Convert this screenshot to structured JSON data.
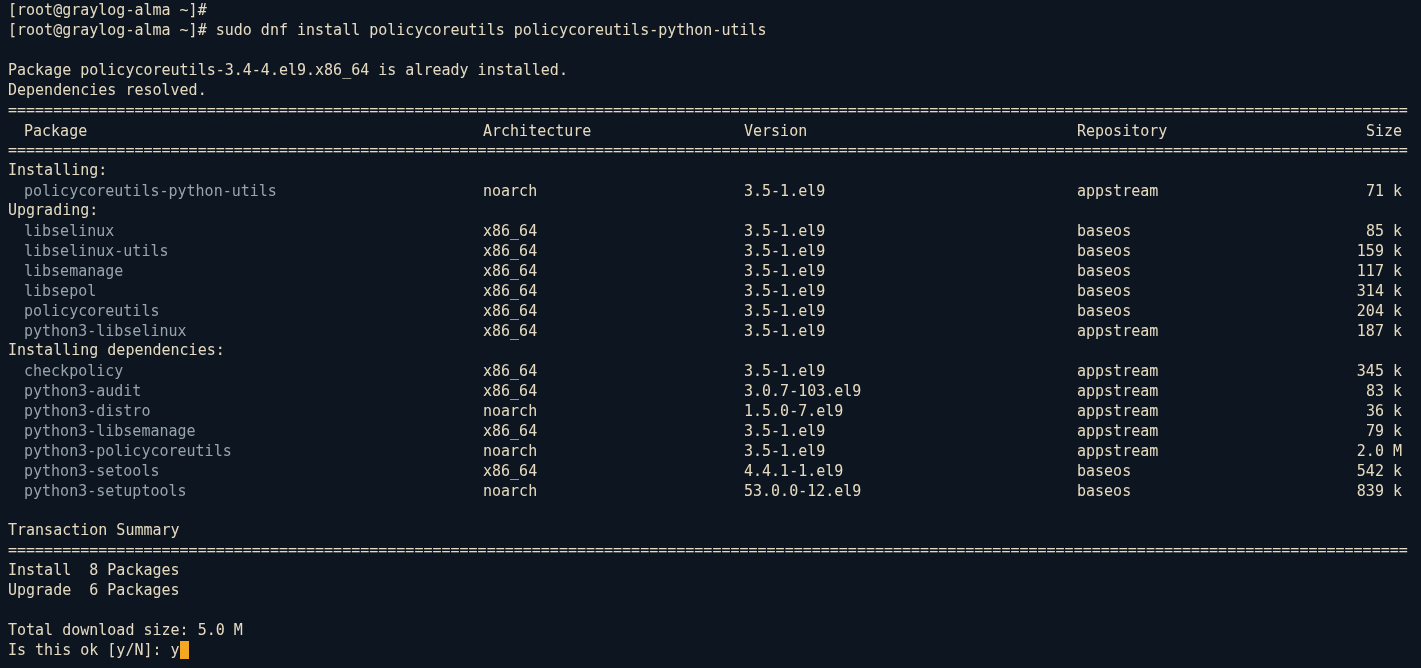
{
  "lines": [
    {
      "kind": "text",
      "text": "[root@graylog-alma ~]#"
    },
    {
      "kind": "text",
      "text": "[root@graylog-alma ~]# sudo dnf install policycoreutils policycoreutils-python-utils"
    },
    {
      "kind": "blank"
    },
    {
      "kind": "text",
      "text": "Package policycoreutils-3.4-4.el9.x86_64 is already installed."
    },
    {
      "kind": "text",
      "text": "Dependencies resolved."
    },
    {
      "kind": "rule",
      "text": "==========================================================================================================================================================="
    },
    {
      "kind": "header",
      "cells": [
        "Package",
        "Architecture",
        "Version",
        "Repository",
        "Size"
      ]
    },
    {
      "kind": "rule",
      "text": "==========================================================================================================================================================="
    },
    {
      "kind": "group",
      "text": "Installing:"
    },
    {
      "kind": "row",
      "cells": [
        "policycoreutils-python-utils",
        "noarch",
        "3.5-1.el9",
        "appstream",
        "71 k"
      ]
    },
    {
      "kind": "group",
      "text": "Upgrading:"
    },
    {
      "kind": "row",
      "cells": [
        "libselinux",
        "x86_64",
        "3.5-1.el9",
        "baseos",
        "85 k"
      ]
    },
    {
      "kind": "row",
      "cells": [
        "libselinux-utils",
        "x86_64",
        "3.5-1.el9",
        "baseos",
        "159 k"
      ]
    },
    {
      "kind": "row",
      "cells": [
        "libsemanage",
        "x86_64",
        "3.5-1.el9",
        "baseos",
        "117 k"
      ]
    },
    {
      "kind": "row",
      "cells": [
        "libsepol",
        "x86_64",
        "3.5-1.el9",
        "baseos",
        "314 k"
      ]
    },
    {
      "kind": "row",
      "cells": [
        "policycoreutils",
        "x86_64",
        "3.5-1.el9",
        "baseos",
        "204 k"
      ]
    },
    {
      "kind": "row",
      "cells": [
        "python3-libselinux",
        "x86_64",
        "3.5-1.el9",
        "appstream",
        "187 k"
      ]
    },
    {
      "kind": "group",
      "text": "Installing dependencies:"
    },
    {
      "kind": "row",
      "cells": [
        "checkpolicy",
        "x86_64",
        "3.5-1.el9",
        "appstream",
        "345 k"
      ]
    },
    {
      "kind": "row",
      "cells": [
        "python3-audit",
        "x86_64",
        "3.0.7-103.el9",
        "appstream",
        "83 k"
      ]
    },
    {
      "kind": "row",
      "cells": [
        "python3-distro",
        "noarch",
        "1.5.0-7.el9",
        "appstream",
        "36 k"
      ]
    },
    {
      "kind": "row",
      "cells": [
        "python3-libsemanage",
        "x86_64",
        "3.5-1.el9",
        "appstream",
        "79 k"
      ]
    },
    {
      "kind": "row",
      "cells": [
        "python3-policycoreutils",
        "noarch",
        "3.5-1.el9",
        "appstream",
        "2.0 M"
      ]
    },
    {
      "kind": "row",
      "cells": [
        "python3-setools",
        "x86_64",
        "4.4.1-1.el9",
        "baseos",
        "542 k"
      ]
    },
    {
      "kind": "row",
      "cells": [
        "python3-setuptools",
        "noarch",
        "53.0.0-12.el9",
        "baseos",
        "839 k"
      ]
    },
    {
      "kind": "blank"
    },
    {
      "kind": "text",
      "text": "Transaction Summary"
    },
    {
      "kind": "rule",
      "text": "==========================================================================================================================================================="
    },
    {
      "kind": "text",
      "text": "Install  8 Packages"
    },
    {
      "kind": "text",
      "text": "Upgrade  6 Packages"
    },
    {
      "kind": "blank"
    },
    {
      "kind": "text",
      "text": "Total download size: 5.0 M"
    },
    {
      "kind": "input",
      "text": "Is this ok [y/N]: ",
      "value": "y",
      "cursor_visible": true
    }
  ]
}
